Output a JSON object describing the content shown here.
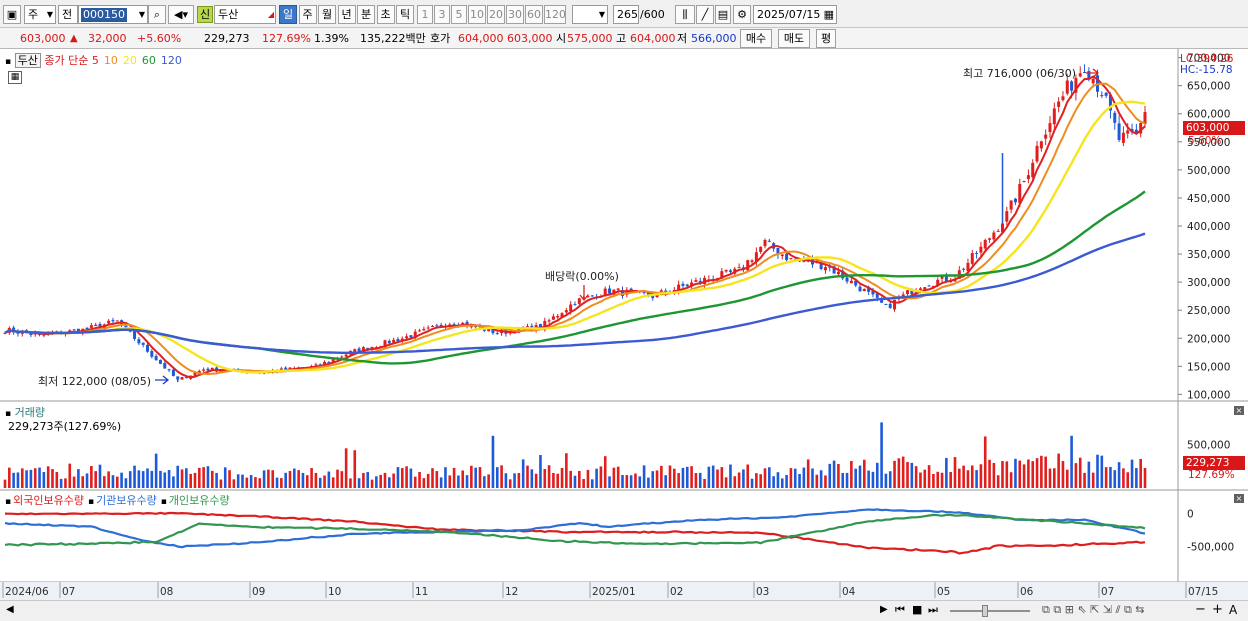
{
  "toolbar": {
    "market": "주",
    "prefix": "전",
    "code": "000150",
    "stock_name": "두산",
    "sin_badge": "신",
    "periods": [
      "일",
      "주",
      "월",
      "년",
      "분",
      "초",
      "틱"
    ],
    "active_period": "일",
    "intervals": [
      "1",
      "3",
      "5",
      "10",
      "20",
      "30",
      "60",
      "120"
    ],
    "count": "265",
    "count_total": "/600",
    "date": "2025/07/15"
  },
  "quote": {
    "price": "603,000",
    "change_arrow": "▲",
    "change": "32,000",
    "change_pct": "+5.60%",
    "volume": "229,273",
    "volume_ratio": "127.69%",
    "turnover": "1.39%",
    "amount": "135,222백만",
    "hoga_label": "호가",
    "ask": "604,000",
    "bid": "603,000",
    "open_label": "시",
    "open": "575,000",
    "high_label": "고",
    "high": "604,000",
    "low_label": "저",
    "low": "566,000",
    "buy_button": "매수",
    "sell_button": "매도",
    "eval_button": "평"
  },
  "price_panel": {
    "name_tag": "두산",
    "legend_title": "종가 단순",
    "ma_labels": [
      "5",
      "10",
      "20",
      "60",
      "120"
    ],
    "ma_colors": [
      "#e02020",
      "#f08c1e",
      "#f6e51e",
      "#1e9632",
      "#3c5ad2"
    ],
    "lc": "LC:394.26",
    "hc": "HC:-15.78",
    "high_annotation": "최고 716,000 (06/30)",
    "low_annotation": "최저 122,000 (08/05)",
    "dividend_annotation": "배당락(0.00%)",
    "price_tag": "603,000",
    "pct_tag": "5.60%"
  },
  "volume_panel": {
    "title": "거래량",
    "value": "229,273주(127.69%)",
    "tag_value": "229,273",
    "tag_pct": "127.69%"
  },
  "holding_panel": {
    "legend": [
      "외국인보유수량",
      "기관보유수량",
      "개인보유수량"
    ],
    "colors": [
      "#dc1e1e",
      "#2d6ed7",
      "#329650"
    ]
  },
  "x_axis_labels": [
    "2024/06",
    "07",
    "08",
    "09",
    "10",
    "11",
    "12",
    "2025/01",
    "02",
    "03",
    "04",
    "05",
    "06",
    "07",
    "07/15"
  ],
  "chart_data": {
    "type": "candlestick",
    "price_axis": [
      "700,000",
      "650,000",
      "600,000",
      "550,000",
      "500,000",
      "450,000",
      "400,000",
      "350,000",
      "300,000",
      "250,000",
      "200,000",
      "150,000",
      "100,000"
    ],
    "price_range": [
      90000,
      710000
    ],
    "volume_axis": [
      "500,000"
    ],
    "volume_range": [
      0,
      800000
    ],
    "holding_axis": [
      "0",
      "-500,000"
    ],
    "holding_range": [
      -1000000,
      200000
    ],
    "close_keypoints": [
      [
        0,
        215000
      ],
      [
        8,
        205000
      ],
      [
        18,
        215000
      ],
      [
        26,
        230000
      ],
      [
        34,
        170000
      ],
      [
        40,
        125000
      ],
      [
        46,
        145000
      ],
      [
        60,
        140000
      ],
      [
        72,
        150000
      ],
      [
        80,
        175000
      ],
      [
        92,
        200000
      ],
      [
        104,
        230000
      ],
      [
        114,
        210000
      ],
      [
        124,
        220000
      ],
      [
        132,
        265000
      ],
      [
        140,
        285000
      ],
      [
        150,
        275000
      ],
      [
        160,
        300000
      ],
      [
        170,
        320000
      ],
      [
        176,
        370000
      ],
      [
        182,
        340000
      ],
      [
        190,
        330000
      ],
      [
        198,
        290000
      ],
      [
        204,
        255000
      ],
      [
        212,
        295000
      ],
      [
        220,
        310000
      ],
      [
        226,
        360000
      ],
      [
        232,
        420000
      ],
      [
        236,
        480000
      ],
      [
        240,
        560000
      ],
      [
        244,
        620000
      ],
      [
        250,
        690000
      ],
      [
        254,
        640000
      ],
      [
        258,
        555000
      ],
      [
        262,
        560000
      ],
      [
        264,
        603000
      ]
    ],
    "volume_keypoints": [
      [
        0,
        170000
      ],
      [
        40,
        200000
      ],
      [
        60,
        150000
      ],
      [
        100,
        180000
      ],
      [
        140,
        180000
      ],
      [
        180,
        190000
      ],
      [
        200,
        250000
      ],
      [
        220,
        260000
      ],
      [
        240,
        260000
      ],
      [
        252,
        300000
      ],
      [
        264,
        229273
      ]
    ],
    "foreign_keypoints": [
      [
        0,
        -10000
      ],
      [
        40,
        0
      ],
      [
        60,
        -50000
      ],
      [
        80,
        -120000
      ],
      [
        100,
        -240000
      ],
      [
        130,
        -280000
      ],
      [
        150,
        -280000
      ],
      [
        175,
        -290000
      ],
      [
        200,
        -520000
      ],
      [
        215,
        -560000
      ],
      [
        222,
        -600000
      ],
      [
        230,
        -490000
      ],
      [
        245,
        -480000
      ],
      [
        264,
        -430000
      ]
    ],
    "institution_keypoints": [
      [
        0,
        -150000
      ],
      [
        20,
        -200000
      ],
      [
        30,
        -380000
      ],
      [
        40,
        -500000
      ],
      [
        60,
        -430000
      ],
      [
        80,
        -310000
      ],
      [
        100,
        -280000
      ],
      [
        120,
        -250000
      ],
      [
        133,
        -150000
      ],
      [
        140,
        -200000
      ],
      [
        160,
        -100000
      ],
      [
        180,
        -60000
      ],
      [
        200,
        60000
      ],
      [
        215,
        30000
      ],
      [
        222,
        10000
      ],
      [
        235,
        -100000
      ],
      [
        250,
        -100000
      ],
      [
        264,
        -300000
      ]
    ],
    "individual_keypoints": [
      [
        0,
        -470000
      ],
      [
        20,
        -460000
      ],
      [
        35,
        -430000
      ],
      [
        45,
        -160000
      ],
      [
        60,
        -210000
      ],
      [
        80,
        -230000
      ],
      [
        100,
        -270000
      ],
      [
        130,
        -420000
      ],
      [
        150,
        -460000
      ],
      [
        175,
        -440000
      ],
      [
        200,
        -120000
      ],
      [
        215,
        -30000
      ],
      [
        222,
        -30000
      ],
      [
        235,
        -90000
      ],
      [
        250,
        -150000
      ],
      [
        264,
        -220000
      ]
    ]
  }
}
